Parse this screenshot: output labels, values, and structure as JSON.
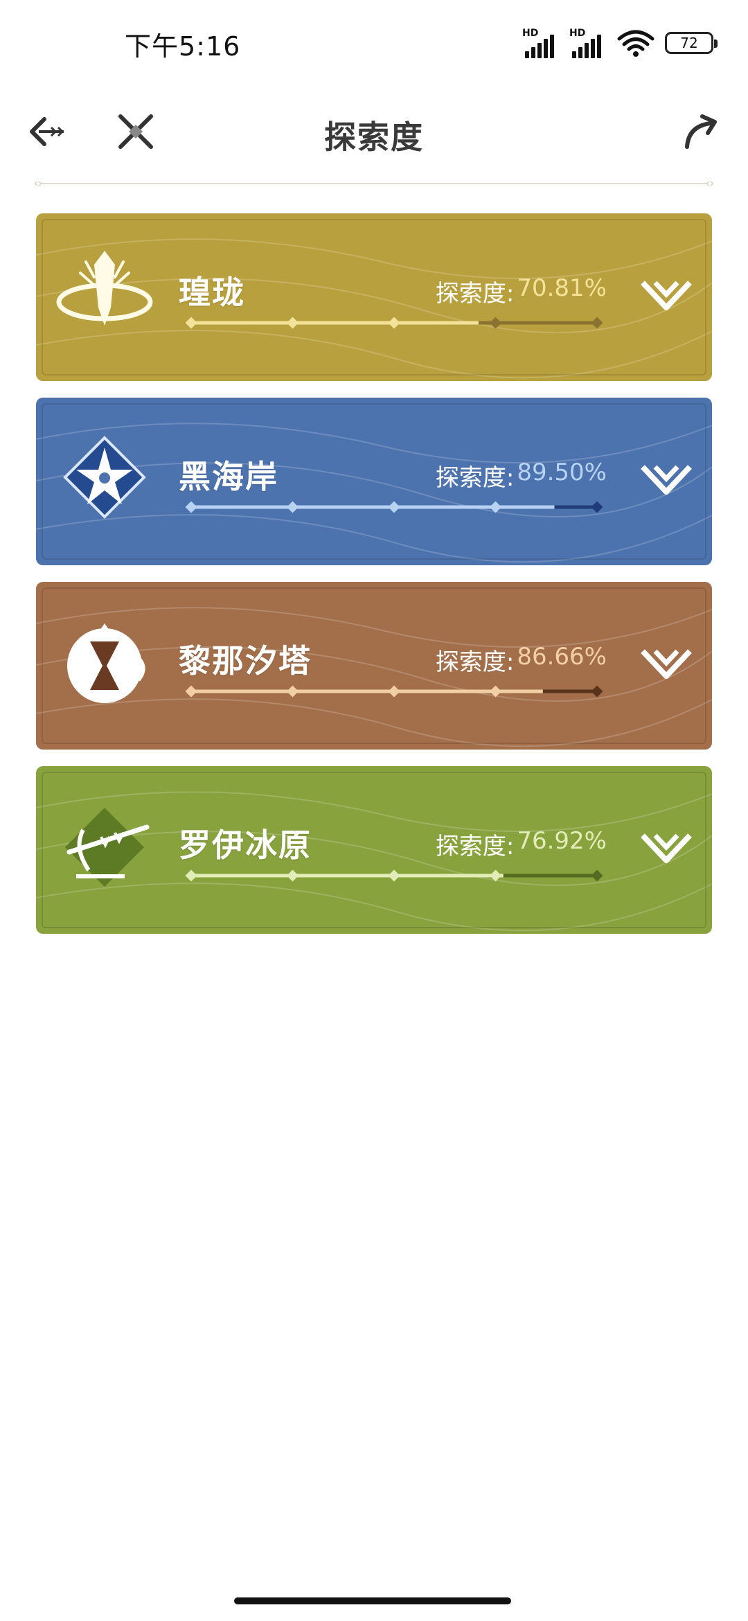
{
  "status_bar": {
    "time": "下午5:16",
    "signal_labels": [
      "HD",
      "HD"
    ],
    "battery": "72"
  },
  "header": {
    "title": "探索度",
    "icons": [
      "back-arrow-icon",
      "crossed-swords-icon",
      "share-icon"
    ]
  },
  "regions": [
    {
      "name": "瑝珑",
      "label": "探索度:",
      "value": "70.81%",
      "progress": 0.7081,
      "colors": {
        "bg": "#b9a03e",
        "fill": "#f3e39a",
        "track": "#8a7330",
        "value": "#f3e39a"
      },
      "emblem": "dragon-emblem-icon"
    },
    {
      "name": "黑海岸",
      "label": "探索度:",
      "value": "89.50%",
      "progress": 0.895,
      "colors": {
        "bg": "#4d73ae",
        "fill": "#b8d2f4",
        "track": "#1f3b78",
        "value": "#b8d2f4"
      },
      "emblem": "star-flower-emblem-icon"
    },
    {
      "name": "黎那汐塔",
      "label": "探索度:",
      "value": "86.66%",
      "progress": 0.8666,
      "colors": {
        "bg": "#a36f4b",
        "fill": "#f2cfa4",
        "track": "#5a331d",
        "value": "#f2cfa4"
      },
      "emblem": "hourglass-emblem-icon"
    },
    {
      "name": "罗伊冰原",
      "label": "探索度:",
      "value": "76.92%",
      "progress": 0.7692,
      "colors": {
        "bg": "#88a23e",
        "fill": "#e2ecb6",
        "track": "#566b22",
        "value": "#e2ecb6"
      },
      "emblem": "spear-emblem-icon"
    }
  ]
}
